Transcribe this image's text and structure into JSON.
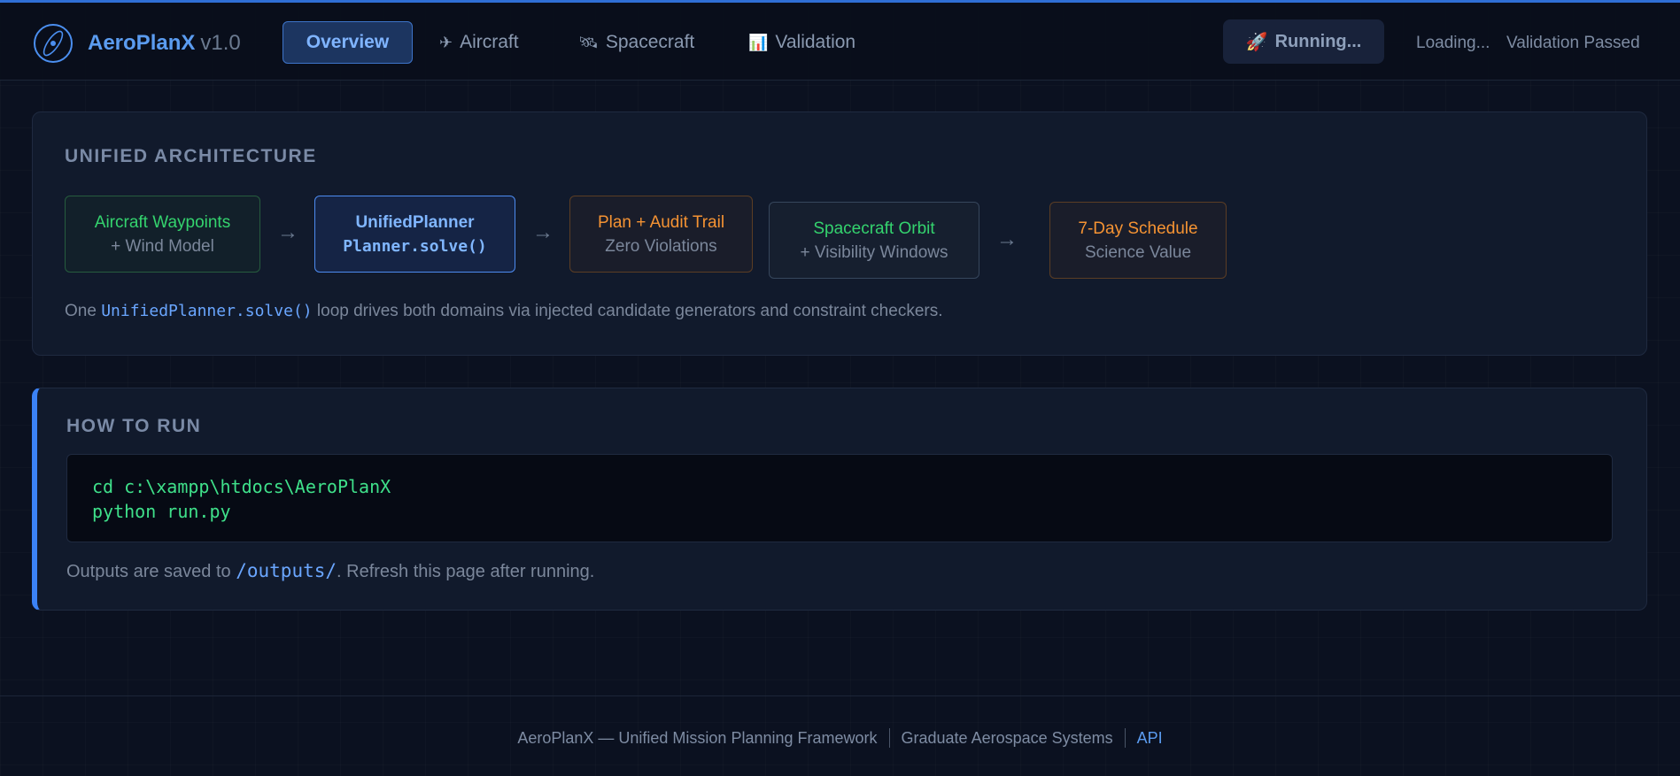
{
  "header": {
    "brand_name": "AeroPlanX",
    "brand_version": "v1.0",
    "nav": [
      {
        "label": "Overview",
        "icon": ""
      },
      {
        "label": "Aircraft",
        "icon": "✈"
      },
      {
        "label": "Spacecraft",
        "icon": "🛰"
      },
      {
        "label": "Validation",
        "icon": "📊"
      }
    ],
    "run_button": {
      "icon": "🚀",
      "label": "Running..."
    },
    "status_loading": "Loading...",
    "status_validation": "Validation Passed"
  },
  "architecture": {
    "title": "UNIFIED ARCHITECTURE",
    "nodes": [
      {
        "line1": "Aircraft Waypoints",
        "line2": "+ Wind Model"
      },
      {
        "line1": "UnifiedPlanner",
        "line2": "Planner.solve()"
      },
      {
        "line1": "Plan + Audit Trail",
        "line2": "Zero Violations"
      },
      {
        "line1": "Spacecraft Orbit",
        "line2": "+ Visibility Windows"
      },
      {
        "line1": "7-Day Schedule",
        "line2": "Science Value"
      }
    ],
    "arrow": "→",
    "desc_prefix": "One",
    "desc_code": "UnifiedPlanner.solve()",
    "desc_suffix": "loop drives both domains via injected candidate generators and constraint checkers."
  },
  "how_to_run": {
    "title": "HOW TO RUN",
    "code_lines": [
      "cd c:\\xampp\\htdocs\\AeroPlanX",
      "python run.py"
    ],
    "outputs_prefix": "Outputs are saved to",
    "outputs_path": "/outputs/",
    "outputs_suffix": ". Refresh this page after running."
  },
  "footer": {
    "title": "AeroPlanX — Unified Mission Planning Framework",
    "subtitle": "Graduate Aerospace Systems",
    "link": "API"
  },
  "colors": {
    "accent_blue": "#5b9cf0",
    "success_green": "#34d36e",
    "warning_orange": "#f59333",
    "background": "#0b1120"
  }
}
